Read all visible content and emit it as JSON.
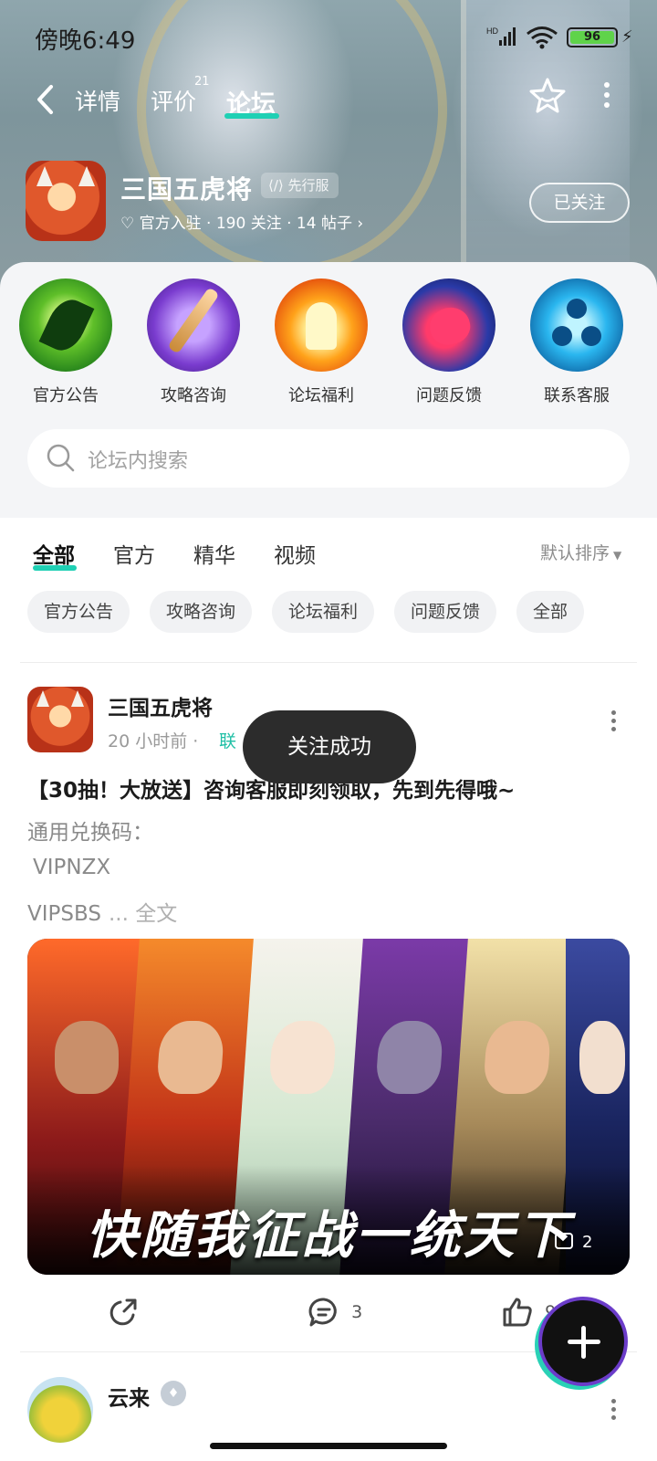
{
  "status_bar": {
    "time": "傍晚6:49",
    "network": "HD",
    "battery": "96"
  },
  "nav": {
    "tabs": [
      {
        "label": "详情",
        "active": false
      },
      {
        "label": "评价",
        "active": false,
        "badge": "21"
      },
      {
        "label": "论坛",
        "active": true
      }
    ]
  },
  "game": {
    "name": "三国五虎将",
    "tag": "先行服",
    "meta": "官方入驻 · 190 关注 · 14 帖子",
    "follow_label": "已关注"
  },
  "shortcuts": [
    {
      "label": "官方公告",
      "icon": "leaf-icon"
    },
    {
      "label": "攻略咨询",
      "icon": "sword-icon"
    },
    {
      "label": "论坛福利",
      "icon": "gift-glow-icon"
    },
    {
      "label": "问题反馈",
      "icon": "heart-icon"
    },
    {
      "label": "联系客服",
      "icon": "orb-icon"
    }
  ],
  "search": {
    "placeholder": "论坛内搜索"
  },
  "filter_tabs": [
    {
      "label": "全部",
      "active": true
    },
    {
      "label": "官方",
      "active": false
    },
    {
      "label": "精华",
      "active": false
    },
    {
      "label": "视频",
      "active": false
    }
  ],
  "sort_label": "默认排序",
  "chips": [
    "官方公告",
    "攻略咨询",
    "论坛福利",
    "问题反馈",
    "全部"
  ],
  "toast": "关注成功",
  "post": {
    "author": "三国五虎将",
    "time": "20 小时前 ·",
    "link_fragment": "联",
    "title": "【30抽！大放送】咨询客服即刻领取，先到先得哦~",
    "lines": [
      "通用兑换码：",
      "VIPNZX",
      "VIPSBS"
    ],
    "more_label": "... 全文",
    "image_slogan": "快随我征战一统天下",
    "image_count": "2",
    "comment_count": "3",
    "like_count": "9"
  },
  "next_post": {
    "author": "云来"
  },
  "colors": {
    "accent": "#1fd0b4",
    "toast_bg": "#2c2c2c"
  }
}
